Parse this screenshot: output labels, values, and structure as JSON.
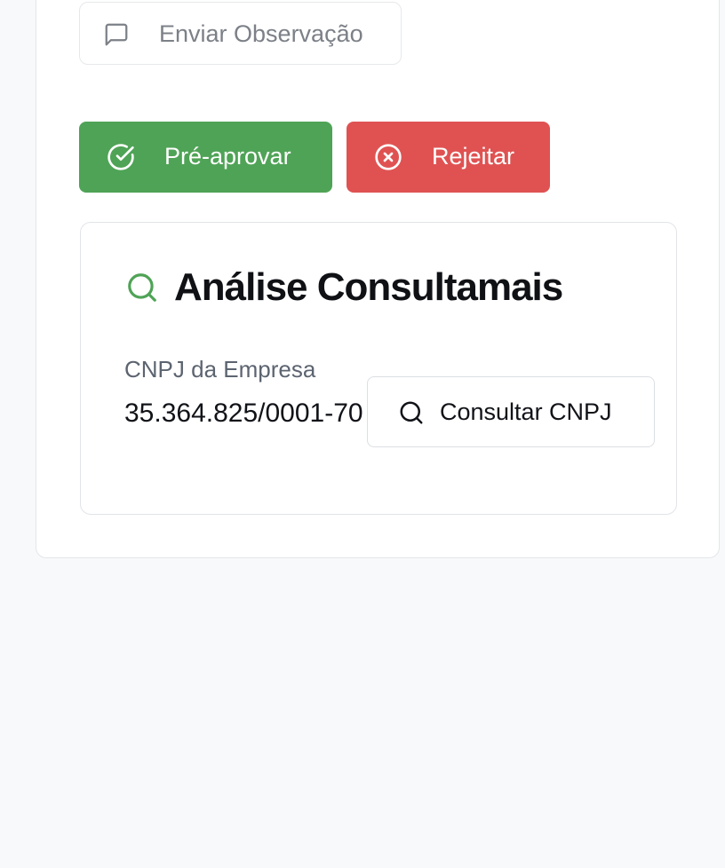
{
  "observation": {
    "send_label": "Enviar Observação",
    "icon": "message-square-icon"
  },
  "actions": {
    "approve_label": "Pré-aprovar",
    "approve_icon": "check-circle-icon",
    "reject_label": "Rejeitar",
    "reject_icon": "x-circle-icon"
  },
  "analysis": {
    "title": "Análise Consultamais",
    "title_icon": "search-icon",
    "cnpj_label": "CNPJ da Empresa",
    "cnpj_value": "35.364.825/0001-70",
    "consult_label": "Consultar CNPJ",
    "consult_icon": "search-icon"
  },
  "colors": {
    "approve": "#4fa356",
    "reject": "#e05252",
    "accent_green": "#4fa356",
    "page_background": "#f8f9fb"
  }
}
